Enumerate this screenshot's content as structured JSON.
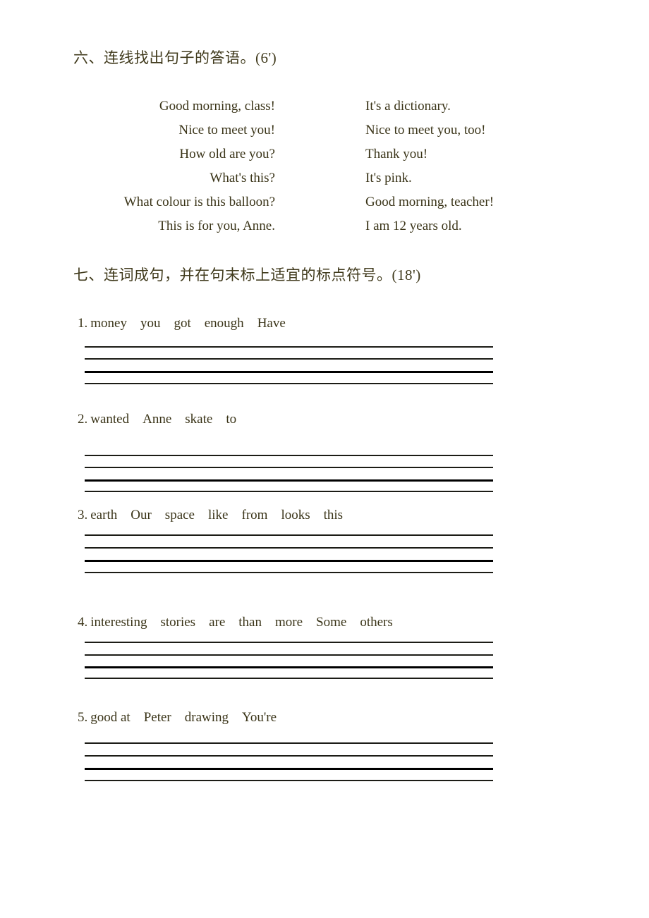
{
  "document": {
    "background_color": "#ffffff",
    "text_color": "#3a3418"
  },
  "sections": {
    "six": {
      "heading": "六、连线找出句子的答语。(6')",
      "matching": {
        "left_column": [
          "Good morning, class!",
          "Nice to meet you!",
          "How old are you?",
          "What's this?",
          "What colour is this balloon?",
          "This is for you, Anne."
        ],
        "right_column": [
          "It's a dictionary.",
          "Nice to meet you, too!",
          "Thank you!",
          "It's pink.",
          "Good morning, teacher!",
          "I am 12 years old."
        ]
      }
    },
    "seven": {
      "heading": "七、连词成句，并在句末标上适宜的标点符号。(18')",
      "items": [
        {
          "number": "1.",
          "words": [
            "money",
            "you",
            "got",
            "enough",
            "Have"
          ]
        },
        {
          "number": "2.",
          "words": [
            "wanted",
            "Anne",
            "skate",
            "to"
          ]
        },
        {
          "number": "3.",
          "words": [
            "earth",
            "Our",
            "space",
            "like",
            "from",
            "looks",
            "this"
          ]
        },
        {
          "number": "4.",
          "words": [
            "interesting",
            "stories",
            "are",
            "than",
            "more",
            "Some",
            "others"
          ]
        },
        {
          "number": "5.",
          "words": [
            "good at",
            "Peter",
            "drawing",
            "You're"
          ]
        }
      ]
    }
  }
}
